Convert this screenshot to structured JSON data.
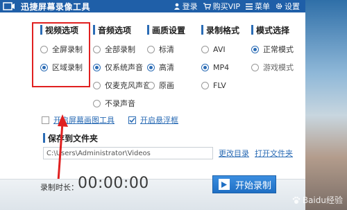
{
  "titlebar": {
    "app_title": "迅捷屏幕录像工具",
    "login": "登录",
    "buy_vip": "购买VIP",
    "menu": "菜单",
    "settings": "设置"
  },
  "columns": {
    "video": {
      "heading": "视频选项",
      "options": [
        {
          "label": "全屏录制",
          "selected": false
        },
        {
          "label": "区域录制",
          "selected": true
        }
      ]
    },
    "audio": {
      "heading": "音频选项",
      "options": [
        {
          "label": "全部录制",
          "selected": false
        },
        {
          "label": "仅系统声音",
          "selected": true
        },
        {
          "label": "仅麦克风声音",
          "selected": false
        },
        {
          "label": "不录声音",
          "selected": false
        }
      ]
    },
    "quality": {
      "heading": "画质设置",
      "options": [
        {
          "label": "标清",
          "selected": false
        },
        {
          "label": "高清",
          "selected": true
        },
        {
          "label": "原画",
          "selected": false
        }
      ]
    },
    "format": {
      "heading": "录制格式",
      "options": [
        {
          "label": "AVI",
          "selected": false
        },
        {
          "label": "MP4",
          "selected": true
        },
        {
          "label": "FLV",
          "selected": false
        }
      ]
    },
    "mode": {
      "heading": "模式选择",
      "options": [
        {
          "label": "正常模式",
          "selected": true
        },
        {
          "label": "游戏模式",
          "selected": false
        }
      ]
    }
  },
  "checkboxes": {
    "screen_layer": {
      "label": "开启屏幕画图工具",
      "checked": false
    },
    "floating_frame": {
      "label": "开启悬浮框",
      "checked": true
    }
  },
  "save": {
    "heading": "保存到文件夹",
    "path": "C:\\Users\\Administrator\\Videos",
    "change_dir": "更改目录",
    "open_folder": "打开文件夹"
  },
  "footer": {
    "rec_label": "录制时长：",
    "rec_time": "00:00:00",
    "start_button": "开始录制"
  },
  "colors": {
    "accent": "#2b6cb5",
    "titlebar": "#1f5fa8",
    "highlight": "#e02020"
  },
  "watermark": "Baidu经验"
}
